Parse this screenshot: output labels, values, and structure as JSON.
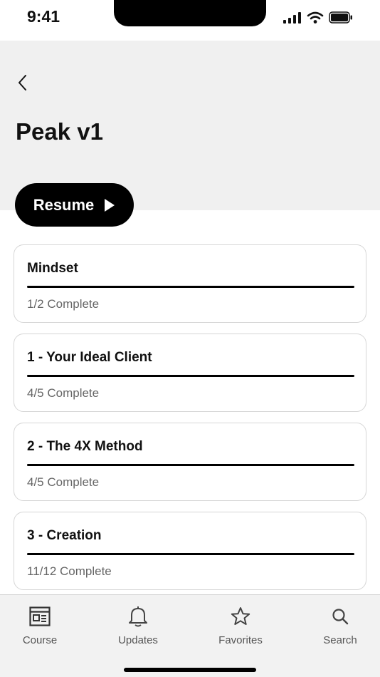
{
  "status_bar": {
    "time": "9:41"
  },
  "header": {
    "title": "Peak v1",
    "resume_label": "Resume"
  },
  "modules": [
    {
      "title": "Mindset",
      "status": "1/2 Complete",
      "progress": 0.5
    },
    {
      "title": "1 - Your Ideal Client",
      "status": "4/5 Complete",
      "progress": 0.8
    },
    {
      "title": "2 - The 4X Method",
      "status": "4/5 Complete",
      "progress": 0.8
    },
    {
      "title": "3 - Creation",
      "status": "11/12 Complete",
      "progress": 0.92
    }
  ],
  "tab_bar": {
    "items": [
      {
        "label": "Course",
        "icon": "course-icon"
      },
      {
        "label": "Updates",
        "icon": "bell-icon"
      },
      {
        "label": "Favorites",
        "icon": "star-icon"
      },
      {
        "label": "Search",
        "icon": "search-icon"
      }
    ]
  },
  "colors": {
    "accent": "#000000",
    "header_bg": "#f0f0f0",
    "tab_bar_bg": "#f2f2f2",
    "muted_text": "#666666"
  }
}
